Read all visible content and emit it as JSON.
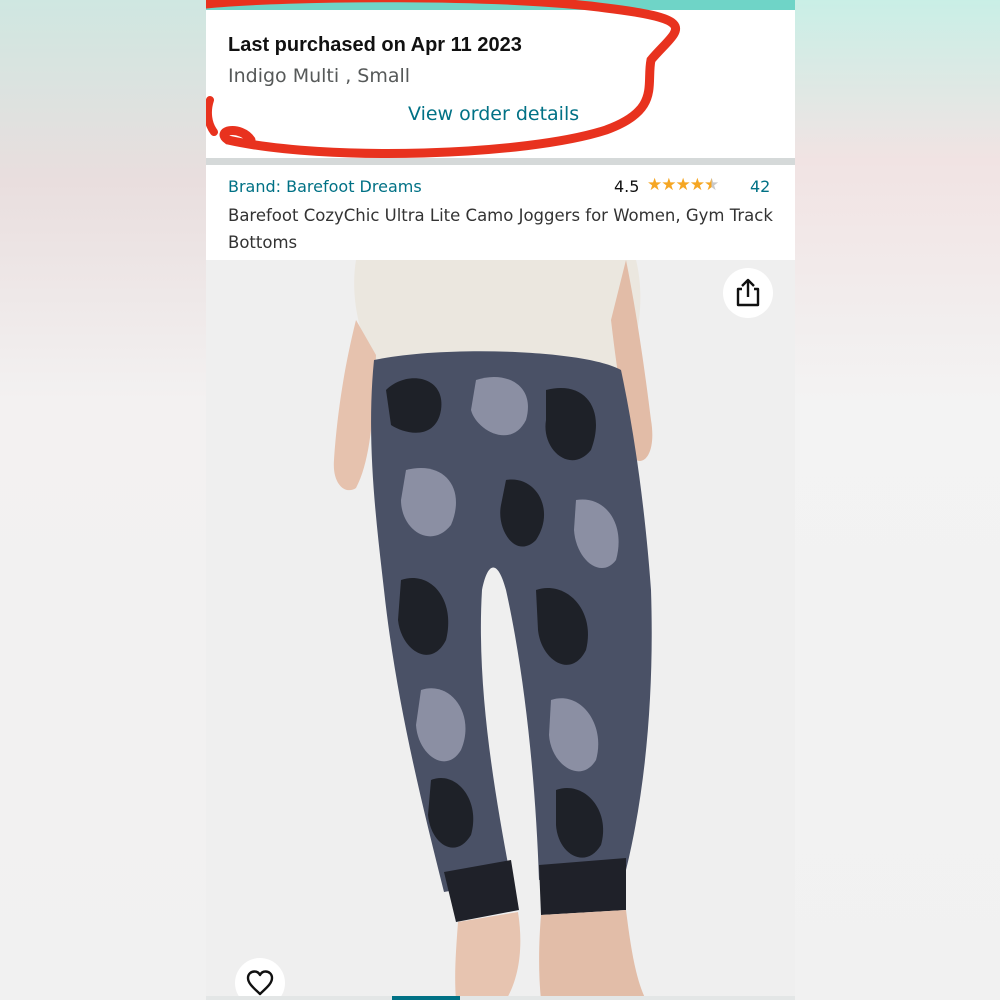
{
  "purchase": {
    "title": "Last purchased on Apr 11 2023",
    "variant": "Indigo Multi , Small",
    "link": "View order details"
  },
  "product": {
    "brand": "Brand: Barefoot Dreams",
    "rating": "4.5",
    "rating_value": 4.5,
    "rating_count": "42",
    "title": "Barefoot CozyChic Ultra Lite Camo Joggers for Women, Gym Track Bottoms"
  },
  "icons": {
    "share": "share-icon",
    "favorite": "heart-icon",
    "stars": "star-rating-icon"
  },
  "colors": {
    "link": "#007185",
    "star": "#f5a623",
    "annotation": "#e8321e"
  }
}
